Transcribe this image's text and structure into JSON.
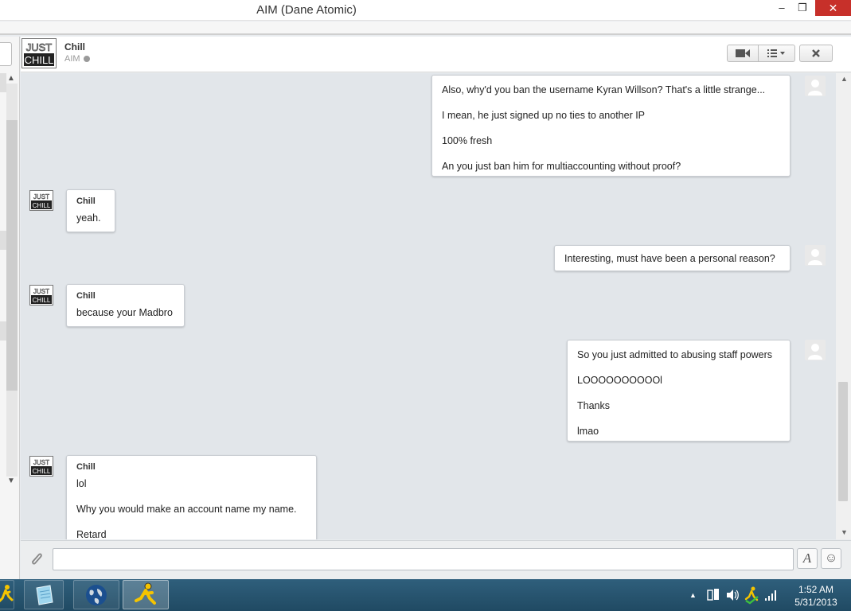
{
  "window": {
    "title": "AIM (Dane Atomic)",
    "min_glyph": "–",
    "max_glyph": "❐",
    "close_glyph": "✕"
  },
  "header": {
    "contact_name": "Chill",
    "service": "AIM",
    "avatar_text_top": "JUST",
    "avatar_text_bottom": "CHILL"
  },
  "messages": [
    {
      "direction": "out",
      "lines": [
        "Also, why'd you ban the username Kyran Willson? That's a little strange...",
        "I mean, he just signed up no ties to another IP",
        "100% fresh",
        "An you just ban him for multiaccounting without proof?"
      ]
    },
    {
      "direction": "in",
      "sender": "Chill",
      "lines": [
        "yeah."
      ]
    },
    {
      "direction": "out",
      "lines": [
        "Interesting, must have been a personal reason?"
      ]
    },
    {
      "direction": "in",
      "sender": "Chill",
      "lines": [
        "because your Madbro"
      ]
    },
    {
      "direction": "out",
      "lines": [
        "So you just admitted to abusing staff powers",
        "LOOOOOOOOOOl",
        "Thanks",
        "lmao"
      ]
    },
    {
      "direction": "in",
      "sender": "Chill",
      "lines": [
        "lol",
        "Why you would make an account name my name.",
        "Retard"
      ]
    }
  ],
  "input": {
    "placeholder": "",
    "value": ""
  },
  "format_button_glyph": "A",
  "emoji_button_glyph": "☺",
  "icons": {
    "attach": "paperclip-icon",
    "video": "video-camera-icon",
    "menu": "list-menu-icon",
    "close": "close-icon",
    "font": "font-format-icon",
    "emoji": "smiley-icon"
  },
  "taskbar": {
    "clock_time": "1:52 AM",
    "clock_date": "5/31/2013"
  },
  "colors": {
    "conversation_bg": "#e2e6ea",
    "taskbar": "#2a556f",
    "close_button": "#c7302a"
  }
}
